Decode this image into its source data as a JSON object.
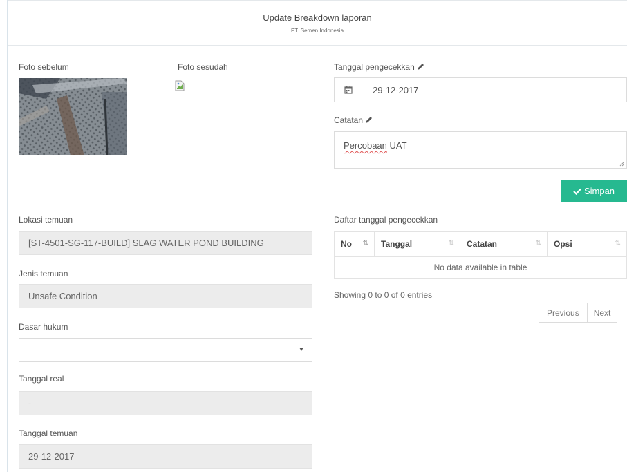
{
  "header": {
    "title": "Update Breakdown laporan",
    "subtitle": "PT. Semen Indonesia"
  },
  "photos": {
    "before_label": "Foto sebelum",
    "after_label": "Foto sesudah"
  },
  "check_form": {
    "date_label": "Tanggal pengecekkan",
    "date_value": "29-12-2017",
    "note_label": "Catatan",
    "note_word1": "Percobaan",
    "note_word2": " UAT",
    "save_label": "Simpan",
    "accent_color": "#26b990"
  },
  "details": {
    "lokasi_label": "Lokasi temuan",
    "lokasi_value": "[ST-4501-SG-117-BUILD] SLAG WATER POND BUILDING",
    "jenis_label": "Jenis temuan",
    "jenis_value": "Unsafe Condition",
    "dasar_label": "Dasar hukum",
    "dasar_value": "",
    "tanggal_real_label": "Tanggal real",
    "tanggal_real_value": "-",
    "tanggal_temuan_label": "Tanggal temuan",
    "tanggal_temuan_value": "29-12-2017"
  },
  "history": {
    "title": "Daftar tanggal pengecekkan",
    "columns": [
      "No",
      "Tanggal",
      "Catatan",
      "Opsi"
    ],
    "empty_text": "No data available in table",
    "info": "Showing 0 to 0 of 0 entries",
    "prev_label": "Previous",
    "next_label": "Next"
  }
}
